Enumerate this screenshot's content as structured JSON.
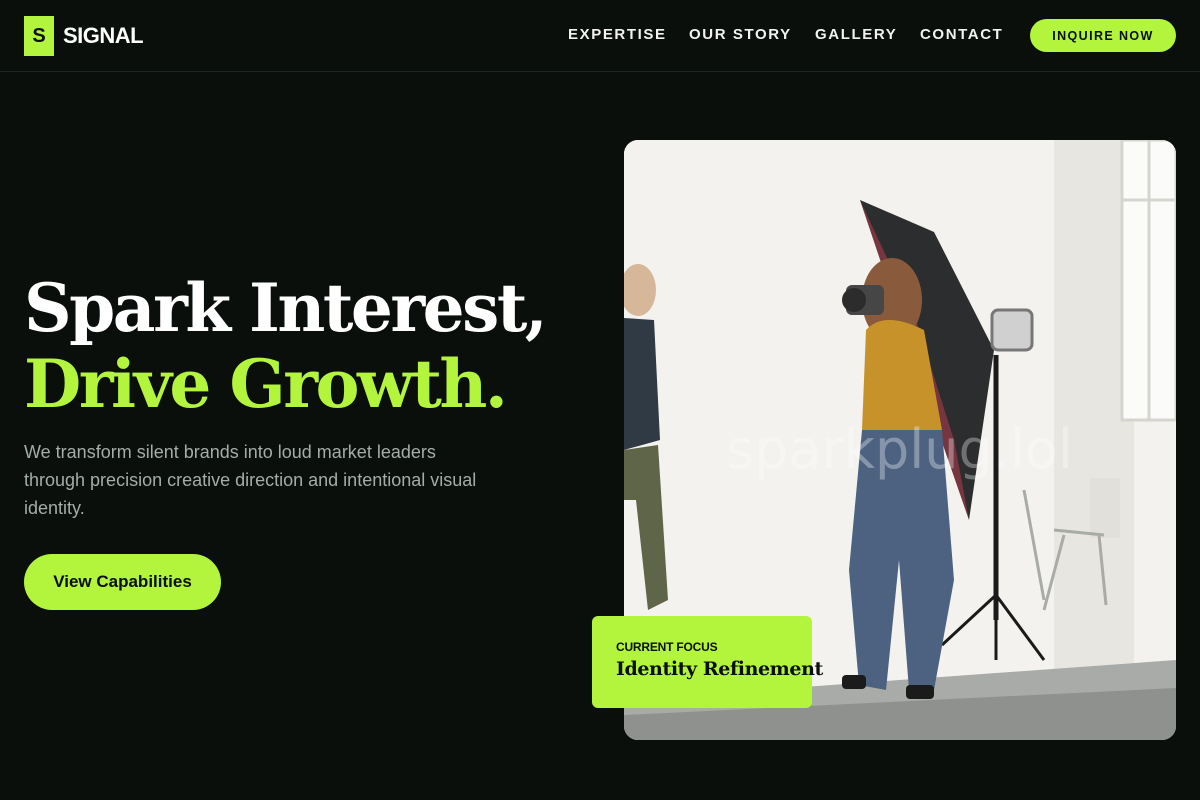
{
  "brand": {
    "mark": "S",
    "name": "SIGNAL",
    "accent": "#b3f53d",
    "background": "#0a0f0b"
  },
  "nav": {
    "items": [
      {
        "label": "EXPERTISE"
      },
      {
        "label": "OUR STORY"
      },
      {
        "label": "GALLERY"
      },
      {
        "label": "CONTACT"
      }
    ],
    "cta_label": "INQUIRE NOW"
  },
  "hero": {
    "headline_line1": "Spark Interest,",
    "headline_line2": "Drive Growth.",
    "subtitle": "We transform silent brands into loud market leaders through precision creative direction and intentional visual identity.",
    "button_label": "View Capabilities"
  },
  "photo": {
    "watermark": "sparkplug.lol"
  },
  "focus_card": {
    "label": "CURRENT FOCUS",
    "value": "Identity Refinement"
  }
}
